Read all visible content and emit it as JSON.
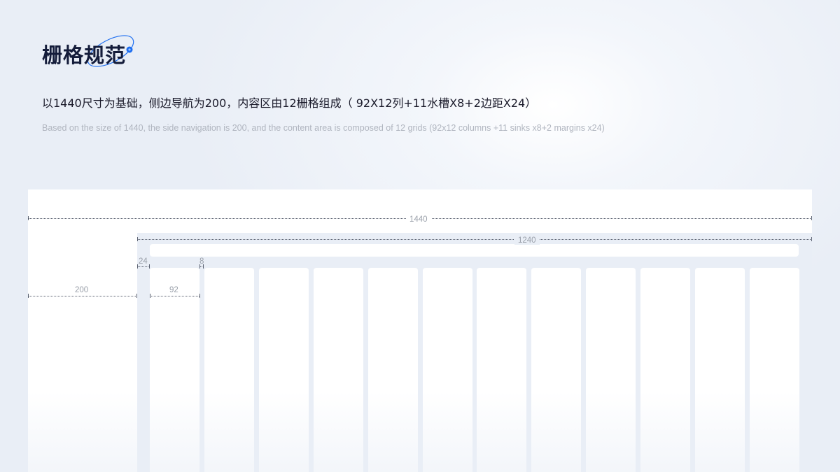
{
  "title": "栅格规范",
  "subtitle_cn": "以1440尺寸为基础，侧边导航为200，内容区由12栅格组成（ 92X12列+11水槽X8+2边距X24）",
  "subtitle_en": "Based on the size of 1440, the side navigation is 200, and the content area is composed of 12 grids (92x12 columns +11 sinks x8+2 margins x24)",
  "dimensions": {
    "total": "1440",
    "content": "1240",
    "sidebar": "200",
    "margin": "24",
    "gutter": "8",
    "column": "92"
  },
  "grid": {
    "columns": 12
  },
  "colors": {
    "title": "#141c3a",
    "accent": "#1e6ef0",
    "panel": "#e9eef6",
    "column": "#ffffff",
    "dimension_text": "#9aa0aa"
  },
  "icons": {
    "logo_decoration": "orbit-ring-icon"
  }
}
